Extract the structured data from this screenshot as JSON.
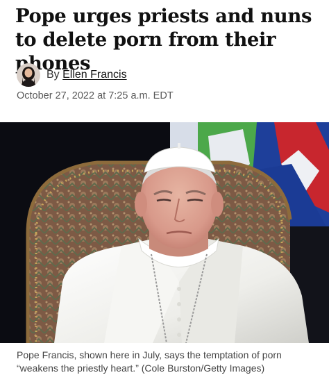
{
  "article": {
    "headline": "Pope urges priests and nuns to delete porn from their phones",
    "byline_prefix": "By",
    "author": "Ellen Francis",
    "timestamp": "October 27, 2022 at 7:25 a.m. EDT",
    "caption": "Pope Francis, shown here in July, says the temptation of porn “weakens the priestly heart.” (Cole Burston/Getty Images)"
  },
  "icons": {
    "avatar": "author-avatar-photo"
  },
  "colors": {
    "headline": "#111111",
    "timestamp": "#5a5a5a",
    "caption": "#444444"
  }
}
